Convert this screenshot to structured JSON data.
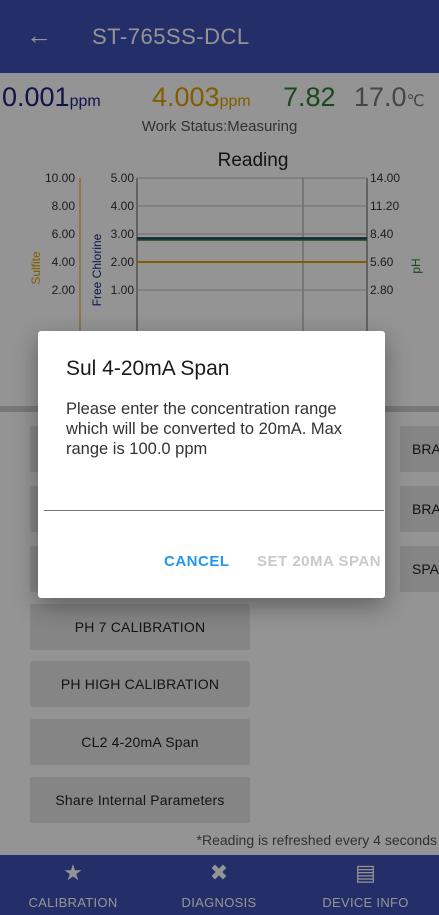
{
  "appbar": {
    "back_icon": "←",
    "title": "ST-765SS-DCL",
    "color": "#3f51b5"
  },
  "readings": {
    "sulfite_value": "0.001",
    "sulfite_unit": "ppm",
    "sulfite_color": "#1a237e",
    "chlorine_value": "4.003",
    "chlorine_unit": "ppm",
    "chlorine_color": "#e0a000",
    "ph_value": "7.82",
    "ph_color": "#2e7d32",
    "temp_value": "17.0",
    "temp_unit": "℃",
    "temp_color": "#777777"
  },
  "status": "Work Status:Measuring",
  "chart_data": {
    "type": "line",
    "title": "Reading",
    "axes": {
      "sulfite": {
        "label": "Sulfite",
        "ticks": [
          "10.00",
          "8.00",
          "6.00",
          "4.00",
          "2.00"
        ],
        "color": "#e0a000"
      },
      "free_chlorine": {
        "label": "Free Chlorine",
        "ticks": [
          "5.00",
          "4.00",
          "3.00",
          "2.00",
          "1.00"
        ],
        "color": "#1a237e"
      },
      "ph": {
        "label": "pH",
        "ticks": [
          "14.00",
          "11.20",
          "8.40",
          "5.60",
          "2.80"
        ],
        "color": "#2e7d32"
      }
    },
    "series": [
      {
        "name": "Free Chlorine",
        "axis": "free_chlorine",
        "values": [
          2.85,
          2.85
        ],
        "color": "#1a237e"
      },
      {
        "name": "pH",
        "axis": "ph",
        "values": [
          7.82,
          7.82
        ],
        "color": "#2e7d32"
      },
      {
        "name": "Sulfite",
        "axis": "sulfite",
        "values": [
          4.0,
          4.0
        ],
        "color": "#e0a000"
      }
    ]
  },
  "buttons": {
    "right1": "BRA",
    "right2": "BRA",
    "right3": "SPA",
    "ph7": "PH 7 CALIBRATION",
    "phhigh": "PH HIGH CALIBRATION",
    "cl2span": "CL2 4-20mA Span",
    "share": "Share Internal Parameters"
  },
  "note": "*Reading is refreshed every 4 seconds",
  "nav": [
    {
      "label": "CALIBRATION",
      "icon": "★"
    },
    {
      "label": "DIAGNOSIS",
      "icon": "✖"
    },
    {
      "label": "DEVICE INFO",
      "icon": "▤"
    }
  ],
  "dialog": {
    "title": "Sul 4-20mA Span",
    "message": "Please enter the concentration range which will be converted to 20mA. Max range is 100.0 ppm",
    "input_value": "",
    "cancel": "CANCEL",
    "set": "SET 20MA SPAN"
  }
}
